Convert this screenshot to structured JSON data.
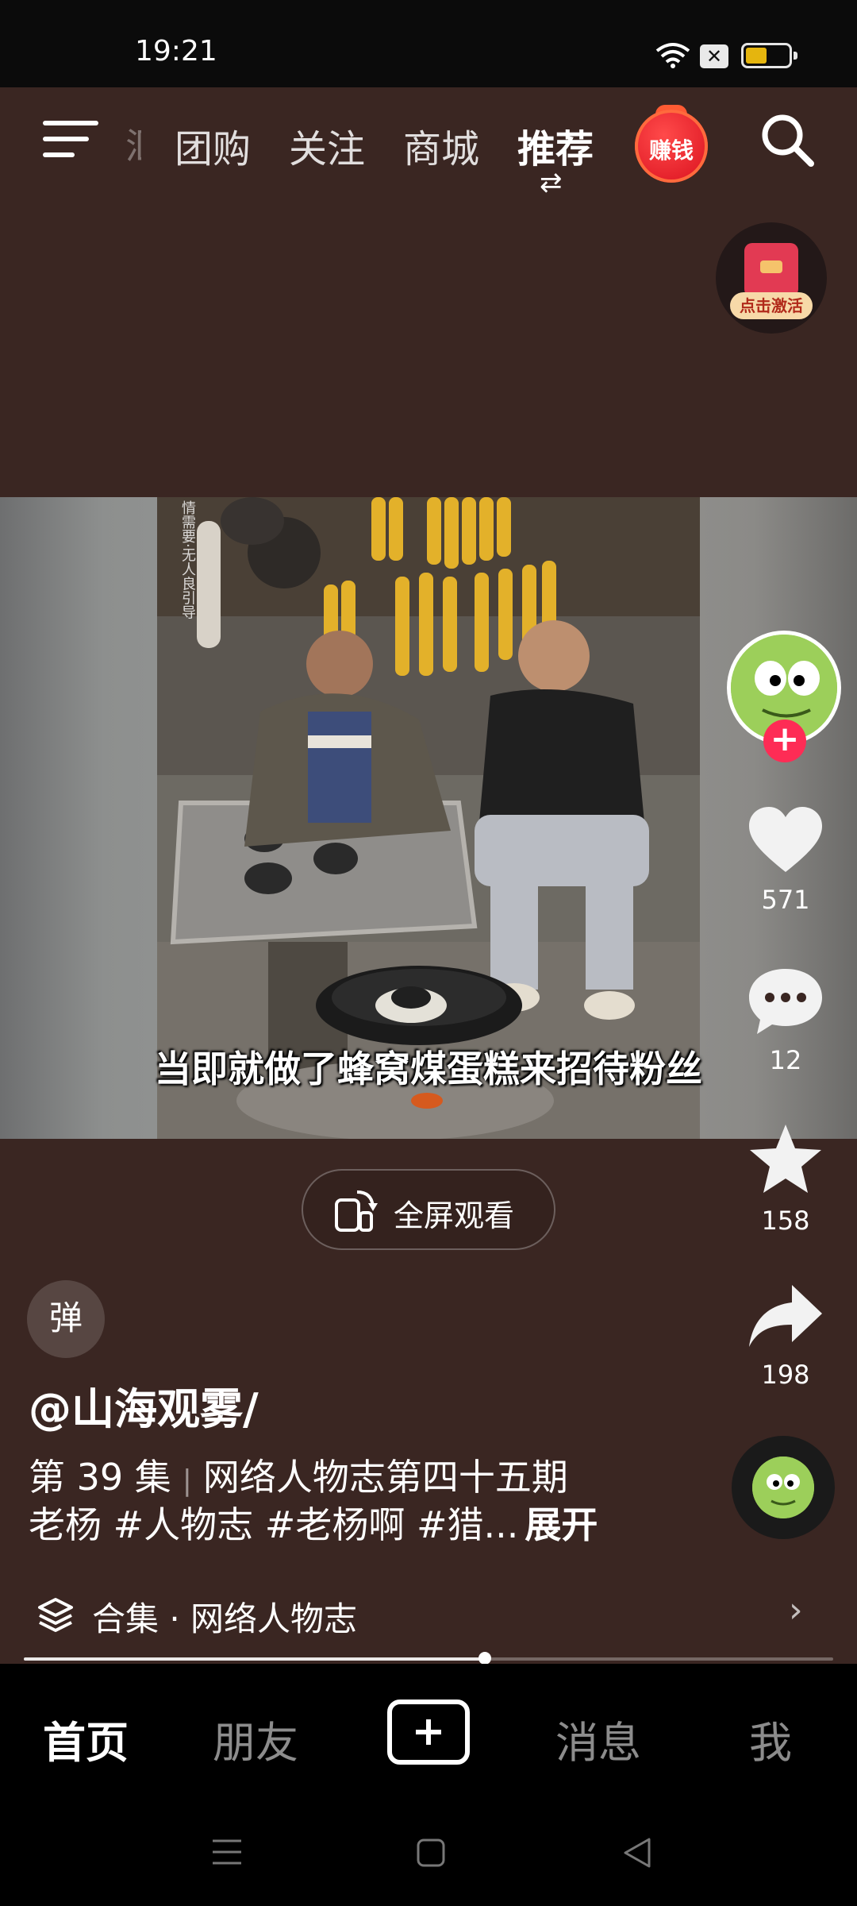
{
  "status_bar": {
    "time": "19:21"
  },
  "top_nav": {
    "faded_tab": "汇",
    "tabs": [
      "团购",
      "关注",
      "商城",
      "推荐"
    ],
    "active_tab": "推荐",
    "earn_badge": "赚钱"
  },
  "red_packet": {
    "label": "点击激活"
  },
  "video": {
    "subtitle": "当即就做了蜂窝煤蛋糕来招待粉丝",
    "side_text": "情需要·无人良引导"
  },
  "actions": {
    "likes": "571",
    "comments": "12",
    "favorites": "158",
    "shares": "198"
  },
  "fullscreen": {
    "label": "全屏观看"
  },
  "danmu": {
    "label": "弹"
  },
  "post": {
    "author": "@山海观雾/",
    "episode": "第 39 集",
    "series_title": "网络人物志第四十五期",
    "caption": "老杨 #人物志 #老杨啊 #猎...",
    "expand": "展开"
  },
  "collection": {
    "label": "合集 · 网络人物志"
  },
  "progress": {
    "fraction": 0.57
  },
  "bottom_tabs": {
    "home": "首页",
    "friends": "朋友",
    "messages": "消息",
    "me": "我"
  },
  "colors": {
    "feed_bg": "#3a2622",
    "accent_red": "#fe2c55",
    "battery": "#e5b50e"
  }
}
